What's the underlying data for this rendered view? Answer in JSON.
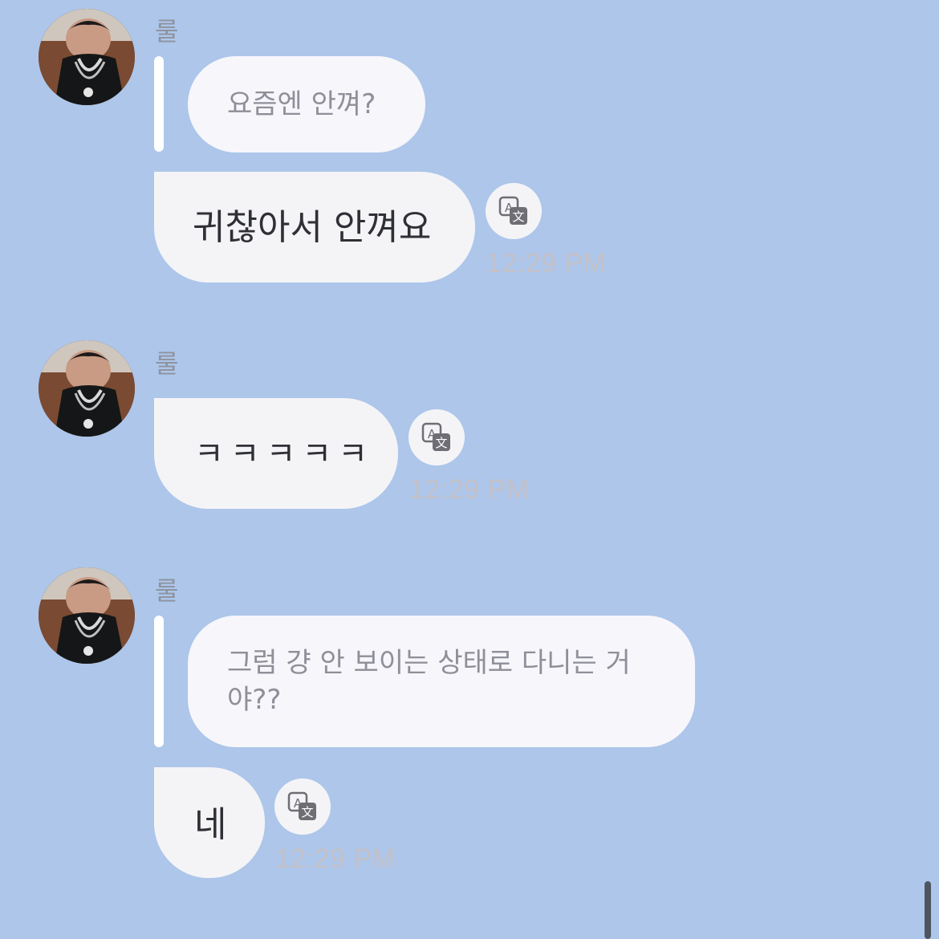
{
  "conversation": {
    "groups": [
      {
        "sender": "룰",
        "quote": "요즘엔 안껴?",
        "message": "귀찮아서 안껴요",
        "time": "12:29 PM"
      },
      {
        "sender": "룰",
        "message": "ㅋㅋㅋㅋㅋ",
        "time": "12:29 PM"
      },
      {
        "sender": "룰",
        "quote": "그럼 걍 안 보이는 상태로 다니는 거야??",
        "message": "네",
        "time": "12:29 PM"
      }
    ]
  },
  "icons": {
    "avatar": "profile-photo",
    "translate": "translate-icon"
  },
  "colors": {
    "background": "#adc6ea",
    "bubble": "#f4f4f7",
    "quote_bubble": "#f7f6fb",
    "timestamp": "#c3c0c7",
    "sender_name": "#8d929e"
  }
}
